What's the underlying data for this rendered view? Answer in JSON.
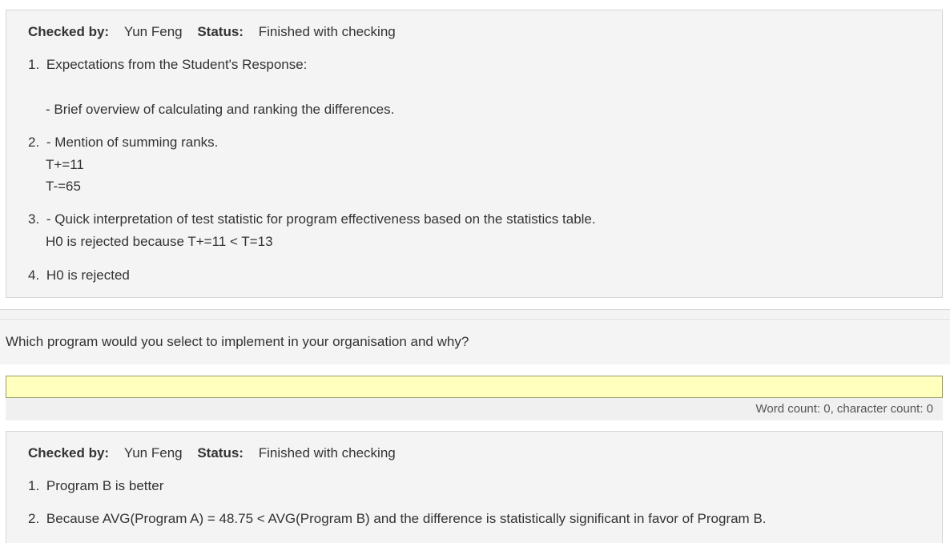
{
  "check1": {
    "checked_by_label": "Checked by:",
    "checked_by_value": "Yun Feng",
    "status_label": "Status:",
    "status_value": "Finished with checking",
    "items": [
      {
        "num": "1.",
        "line1": "Expectations from the Student's Response:"
      },
      {
        "line": "- Brief overview of calculating and ranking the differences."
      },
      {
        "num": "2.",
        "line1": "- Mention of summing ranks.",
        "line2": "T+=11",
        "line3": "T-=65"
      },
      {
        "num": "3.",
        "line1": "- Quick interpretation of test statistic for program effectiveness based on the statistics table.",
        "line2": "H0 is rejected because T+=11 < T=13"
      },
      {
        "num": "4.",
        "line1": "H0 is rejected"
      }
    ]
  },
  "question": {
    "text": "Which program would you select to implement in your organisation and why?"
  },
  "answer": {
    "value": "",
    "word_count": "Word count: 0, character count: 0"
  },
  "check2": {
    "checked_by_label": "Checked by:",
    "checked_by_value": "Yun Feng",
    "status_label": "Status:",
    "status_value": "Finished with checking",
    "items": [
      {
        "num": "1.",
        "line1": "Program B is better"
      },
      {
        "num": "2.",
        "line1": "Because AVG(Program A) = 48.75 < AVG(Program B) and the difference is statistically significant in favor of Program B."
      }
    ]
  }
}
